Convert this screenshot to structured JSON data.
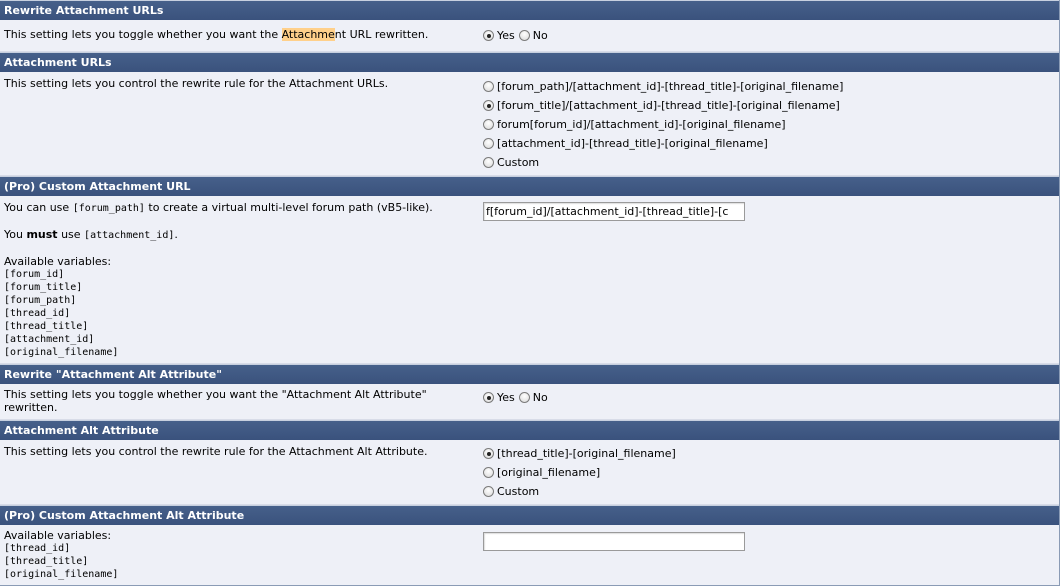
{
  "sections": {
    "rewrite_attachment_urls": {
      "title": "Rewrite Attachment URLs",
      "desc_before": "This setting lets you toggle whether you want the ",
      "desc_highlight": "Attachme",
      "desc_after": "nt URL rewritten.",
      "yes": "Yes",
      "no": "No",
      "selected": "Yes"
    },
    "attachment_urls": {
      "title": "Attachment URLs",
      "desc": "This setting lets you control the rewrite rule for the Attachment URLs.",
      "options": [
        "[forum_path]/[attachment_id]-[thread_title]-[original_filename]",
        "[forum_title]/[attachment_id]-[thread_title]-[original_filename]",
        "forum[forum_id]/[attachment_id]-[original_filename]",
        "[attachment_id]-[thread_title]-[original_filename]",
        "Custom"
      ],
      "selected_index": 1
    },
    "custom_attachment_url": {
      "title": "(Pro) Custom Attachment URL",
      "line1_before": "You can use ",
      "line1_code": "[forum_path]",
      "line1_after": " to create a virtual multi-level forum path (vB5-like).",
      "line2_before": "You ",
      "line2_bold": "must",
      "line2_mid": " use ",
      "line2_code": "[attachment_id]",
      "line2_after": ".",
      "vars_label": "Available variables:",
      "vars": [
        "[forum_id]",
        "[forum_title]",
        "[forum_path]",
        "[thread_id]",
        "[thread_title]",
        "[attachment_id]",
        "[original_filename]"
      ],
      "input_value": "f[forum_id]/[attachment_id]-[thread_title]-[c"
    },
    "rewrite_alt": {
      "title": "Rewrite \"Attachment Alt Attribute\"",
      "desc": "This setting lets you toggle whether you want the \"Attachment Alt Attribute\" rewritten.",
      "yes": "Yes",
      "no": "No",
      "selected": "Yes"
    },
    "alt_attribute": {
      "title": "Attachment Alt Attribute",
      "desc": "This setting lets you control the rewrite rule for the Attachment Alt Attribute.",
      "options": [
        "[thread_title]-[original_filename]",
        "[original_filename]",
        "Custom"
      ],
      "selected_index": 0
    },
    "custom_alt": {
      "title": "(Pro) Custom Attachment Alt Attribute",
      "vars_label": "Available variables:",
      "vars": [
        "[thread_id]",
        "[thread_title]",
        "[original_filename]"
      ],
      "input_value": ""
    }
  }
}
